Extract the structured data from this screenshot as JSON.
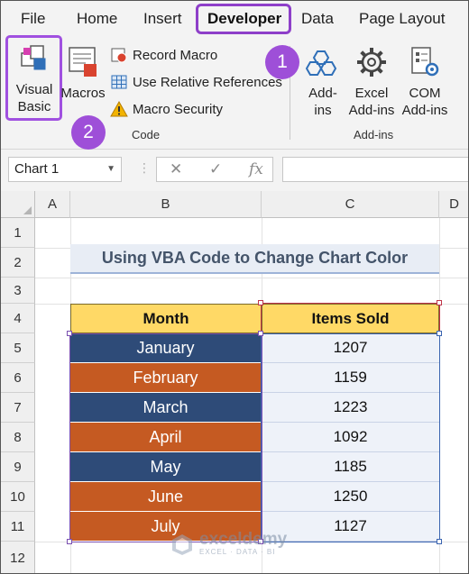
{
  "menu": {
    "items": [
      "File",
      "Home",
      "Insert",
      "Developer",
      "Data",
      "Page Layout"
    ]
  },
  "ribbon": {
    "code_group": {
      "visual_basic_line1": "Visual",
      "visual_basic_line2": "Basic",
      "macros": "Macros",
      "record_macro": "Record Macro",
      "relative_refs": "Use Relative References",
      "macro_security": "Macro Security",
      "label": "Code"
    },
    "addins_group": {
      "addins_line1": "Add-",
      "addins_line2": "ins",
      "excel_addins_line1": "Excel",
      "excel_addins_line2": "Add-ins",
      "com_addins_line1": "COM",
      "com_addins_line2": "Add-ins",
      "label": "Add-ins"
    }
  },
  "callouts": {
    "step1": "1",
    "step2": "2"
  },
  "formula_bar": {
    "name_box": "Chart 1",
    "cancel_glyph": "✕",
    "enter_glyph": "✓",
    "fx_glyph": "fx",
    "formula": ""
  },
  "grid": {
    "columns": [
      "A",
      "B",
      "C",
      "D"
    ],
    "rows": [
      "1",
      "2",
      "3",
      "4",
      "5",
      "6",
      "7",
      "8",
      "9",
      "10",
      "11",
      "12"
    ]
  },
  "sheet": {
    "title": "Using VBA Code to Change Chart Color",
    "headers": {
      "month": "Month",
      "items_sold": "Items Sold"
    },
    "rows": [
      {
        "month": "January",
        "sold": "1207"
      },
      {
        "month": "February",
        "sold": "1159"
      },
      {
        "month": "March",
        "sold": "1223"
      },
      {
        "month": "April",
        "sold": "1092"
      },
      {
        "month": "May",
        "sold": "1185"
      },
      {
        "month": "June",
        "sold": "1250"
      },
      {
        "month": "July",
        "sold": "1127"
      }
    ]
  },
  "colors": {
    "accent_purple": "#9e4fd8",
    "month_blue": "#2e4b78",
    "month_orange": "#c55a22",
    "header_yellow": "#ffd966",
    "title_text": "#44546a"
  },
  "watermark": {
    "name": "exceldemy",
    "tagline": "EXCEL · DATA · BI"
  }
}
